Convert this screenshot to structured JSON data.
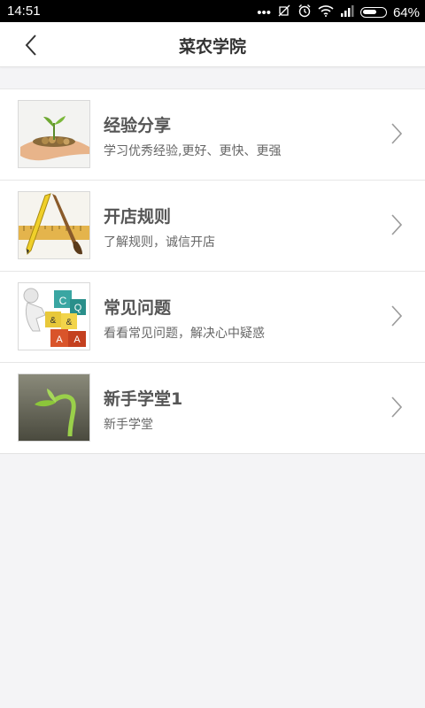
{
  "status_bar": {
    "time": "14:51",
    "battery_percent": "64%",
    "battery_level": 0.64
  },
  "header": {
    "title": "菜农学院"
  },
  "items": [
    {
      "title": "经验分享",
      "subtitle": "学习优秀经验,更好、更快、更强",
      "icon": "seedling-in-hand-image"
    },
    {
      "title": "开店规则",
      "subtitle": "了解规则，诚信开店",
      "icon": "pencil-brush-ruler-image"
    },
    {
      "title": "常见问题",
      "subtitle": "看看常见问题，解决心中疑惑",
      "icon": "qa-blocks-image"
    },
    {
      "title": "新手学堂1",
      "subtitle": "新手学堂",
      "icon": "sprout-image"
    }
  ]
}
